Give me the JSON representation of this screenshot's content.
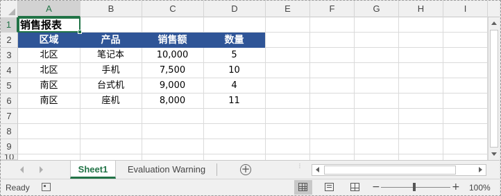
{
  "columns": [
    "A",
    "B",
    "C",
    "D",
    "E",
    "F",
    "G",
    "H",
    "I"
  ],
  "rows": [
    "1",
    "2",
    "3",
    "4",
    "5",
    "6",
    "7",
    "8",
    "9",
    "10"
  ],
  "sheet": {
    "title": "销售报表",
    "table_header": [
      "区域",
      "产品",
      "销售额",
      "数量"
    ],
    "table_rows": [
      [
        "北区",
        "笔记本",
        "10,000",
        "5"
      ],
      [
        "北区",
        "手机",
        "7,500",
        "10"
      ],
      [
        "南区",
        "台式机",
        "9,000",
        "4"
      ],
      [
        "南区",
        "座机",
        "8,000",
        "11"
      ]
    ]
  },
  "selected_cell": "A1",
  "tabs": {
    "sheet1": "Sheet1",
    "evaluation_warning": "Evaluation Warning"
  },
  "status": {
    "ready": "Ready",
    "zoom": "100%"
  },
  "colors": {
    "header_fill": "#2f5597",
    "accent": "#217346"
  }
}
